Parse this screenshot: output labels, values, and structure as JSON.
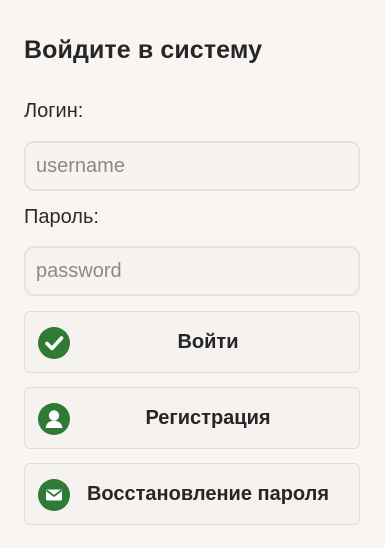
{
  "form": {
    "title": "Войдите в систему",
    "login_label": "Логин:",
    "login_placeholder": "username",
    "password_label": "Пароль:",
    "password_placeholder": "password"
  },
  "buttons": {
    "login": {
      "label": "Войти",
      "icon": "check-circle-icon"
    },
    "register": {
      "label": "Регистрация",
      "icon": "user-icon"
    },
    "restore": {
      "label": "Восстановление пароля",
      "icon": "envelope-icon"
    }
  },
  "colors": {
    "background": "#f9f5f3",
    "icon_green": "#2f7a34",
    "text": "#262626"
  }
}
